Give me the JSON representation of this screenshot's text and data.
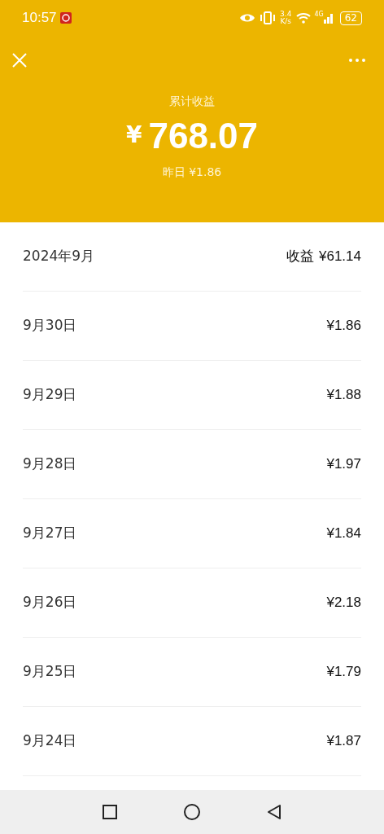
{
  "status_bar": {
    "time": "10:57",
    "speed_value": "3.4",
    "speed_unit": "K/s",
    "network": "4G",
    "battery": "62"
  },
  "header": {
    "title": "累计收益",
    "currency": "¥",
    "total": "768.07",
    "yesterday": "昨日 ¥1.86"
  },
  "month": {
    "label": "2024年9月",
    "earnings_label": "收益",
    "earnings": "¥61.14"
  },
  "days": [
    {
      "date": "9月30日",
      "amount": "¥1.86"
    },
    {
      "date": "9月29日",
      "amount": "¥1.88"
    },
    {
      "date": "9月28日",
      "amount": "¥1.97"
    },
    {
      "date": "9月27日",
      "amount": "¥1.84"
    },
    {
      "date": "9月26日",
      "amount": "¥2.18"
    },
    {
      "date": "9月25日",
      "amount": "¥1.79"
    },
    {
      "date": "9月24日",
      "amount": "¥1.87"
    }
  ]
}
